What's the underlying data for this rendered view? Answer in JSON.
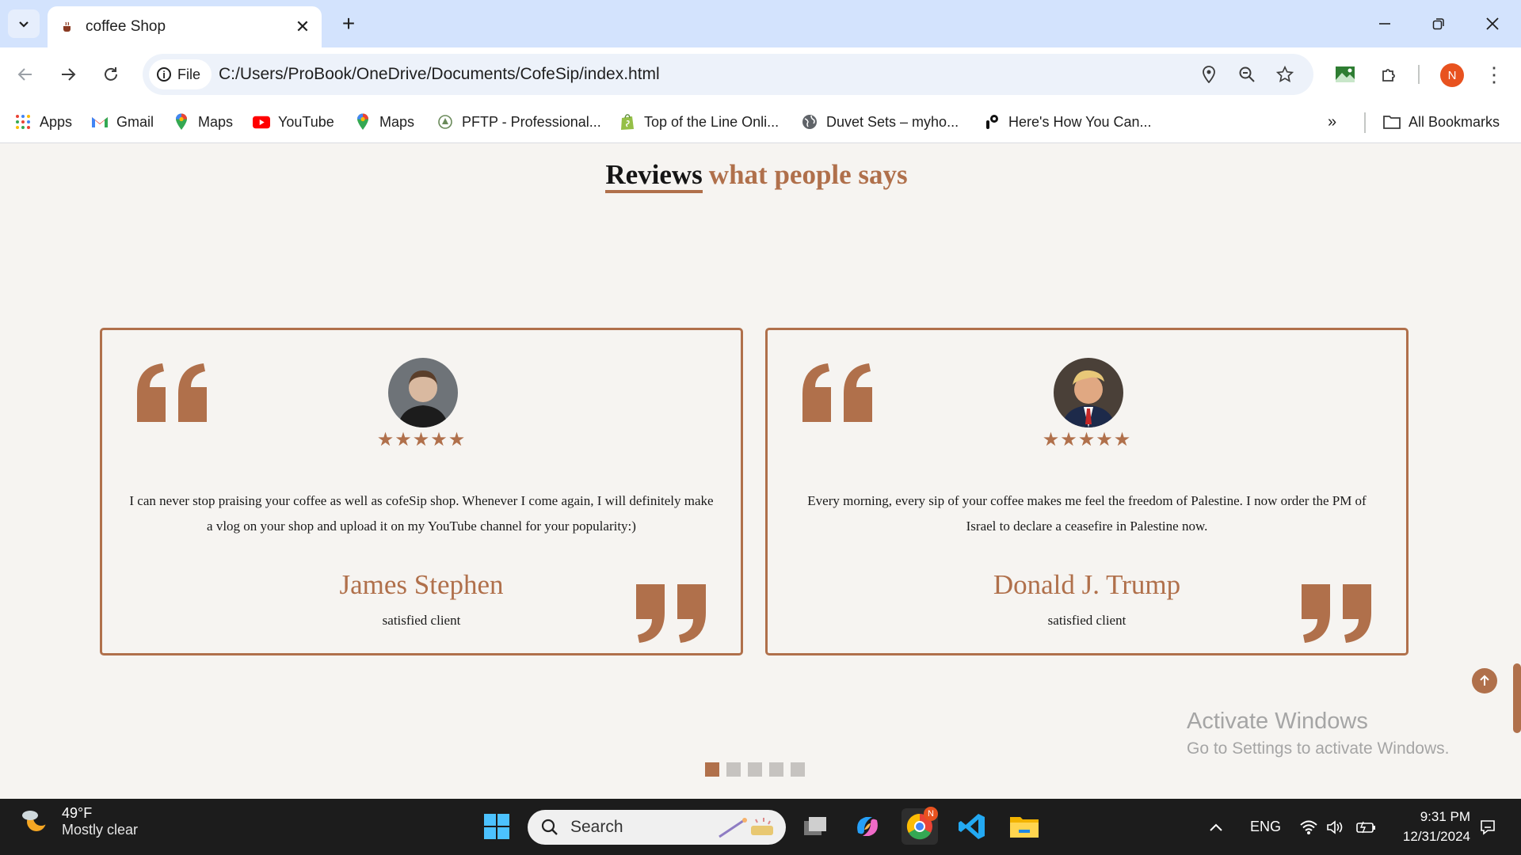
{
  "browser": {
    "tab_title": "coffee Shop",
    "url_chip": "File",
    "url": "C:/Users/ProBook/OneDrive/Documents/CofeSip/index.html",
    "profile_initial": "N",
    "bookmarks": [
      {
        "label": "Apps",
        "icon": "apps-grid-icon"
      },
      {
        "label": "Gmail",
        "icon": "gmail-icon"
      },
      {
        "label": "Maps",
        "icon": "maps-pin-icon"
      },
      {
        "label": "YouTube",
        "icon": "youtube-icon"
      },
      {
        "label": "Maps",
        "icon": "maps-pin-icon"
      },
      {
        "label": "PFTP - Professional...",
        "icon": "pftp-icon"
      },
      {
        "label": "Top of the Line Onli...",
        "icon": "shopify-bag-icon"
      },
      {
        "label": "Duvet Sets – myho...",
        "icon": "globe-icon"
      },
      {
        "label": "Here's How You Can...",
        "icon": "link-icon"
      }
    ],
    "all_bookmarks": "All Bookmarks"
  },
  "page": {
    "heading_main": "Reviews",
    "heading_sub": "what people says",
    "reviews": [
      {
        "text": "I can never stop praising your coffee as well as cofeSip shop. Whenever I come again, I will definitely make a vlog on your shop and upload it on my YouTube channel for your popularity:)",
        "name": "James Stephen",
        "role": "satisfied client",
        "stars": 5,
        "stars_glyph": "★★★★★"
      },
      {
        "text": "Every morning, every sip of your coffee makes me feel the freedom of Palestine. I now order the PM of Israel to declare a ceasefire in Palestine now.",
        "name": "Donald J. Trump",
        "role": "satisfied client",
        "stars": 5,
        "stars_glyph": "★★★★★"
      }
    ],
    "slider_pages": 5,
    "slider_active_index": 0,
    "accent_color": "#b0704b"
  },
  "watermark": {
    "line1": "Activate Windows",
    "line2": "Go to Settings to activate Windows."
  },
  "taskbar": {
    "temperature": "49°F",
    "condition": "Mostly clear",
    "search_placeholder": "Search",
    "chrome_badge": "N",
    "language": "ENG",
    "time": "9:31 PM",
    "date": "12/31/2024"
  }
}
